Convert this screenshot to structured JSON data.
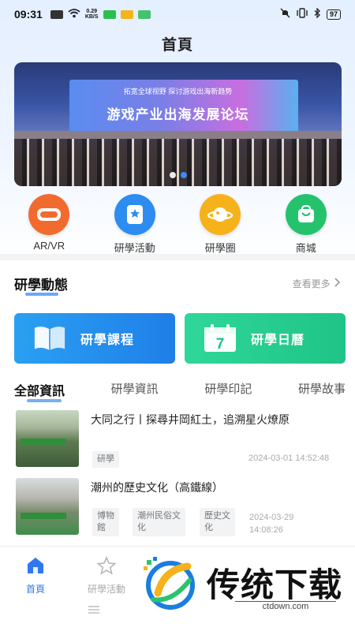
{
  "status_bar": {
    "time": "09:31",
    "net_speed_value": "0.29",
    "net_speed_unit": "KB/S",
    "battery": "97"
  },
  "header": {
    "title": "首頁"
  },
  "banner": {
    "subtitle": "拓宽全球视野 探讨游戏出海新趋势",
    "headline": "游戏产业出海发展论坛",
    "slide_count": 2,
    "active_slide": 1
  },
  "quick_nav": [
    {
      "label": "AR/VR",
      "icon": "vr-goggles-icon",
      "color": "#f26b2e"
    },
    {
      "label": "研學活動",
      "icon": "bookmark-star-icon",
      "color": "#2d8cf0"
    },
    {
      "label": "研學圈",
      "icon": "planet-icon",
      "color": "#f6b21b"
    },
    {
      "label": "商城",
      "icon": "shopping-bag-icon",
      "color": "#25c26e"
    }
  ],
  "dynamics": {
    "title": "研學動態",
    "more": "查看更多"
  },
  "course_cards": [
    {
      "label": "研學課程",
      "icon": "open-book-icon"
    },
    {
      "label": "研學日曆",
      "icon": "calendar-icon",
      "calendar_day": "7"
    }
  ],
  "tabs": [
    {
      "label": "全部資訊",
      "active": true
    },
    {
      "label": "研學資訊",
      "active": false
    },
    {
      "label": "研學印記",
      "active": false
    },
    {
      "label": "研學故事",
      "active": false
    }
  ],
  "news": [
    {
      "title": "大同之行丨探尋井岡紅土，追溯星火燎原",
      "tags": [
        "研學"
      ],
      "date": "2024-03-01 14:52:48"
    },
    {
      "title": "潮州的歷史文化（高鐵線）",
      "tags": [
        "博物館",
        "潮州民俗文化",
        "歷史文化"
      ],
      "tag_lines": [
        [
          "博物",
          "館"
        ],
        [
          "潮州民俗文",
          "化"
        ],
        [
          "歷史文",
          "化"
        ]
      ],
      "date_line1": "2024-03-29",
      "date_line2": "14:08:26"
    }
  ],
  "bottom_nav": [
    {
      "label": "首頁",
      "icon": "home-icon",
      "active": true
    },
    {
      "label": "研學活動",
      "icon": "star-icon",
      "active": false
    }
  ],
  "watermark": {
    "text": "传统下载",
    "url": "ctdown.com"
  },
  "colors": {
    "accent": "#2f78f0",
    "card_blue": "#1f8cf0",
    "card_green": "#24cd8f"
  }
}
